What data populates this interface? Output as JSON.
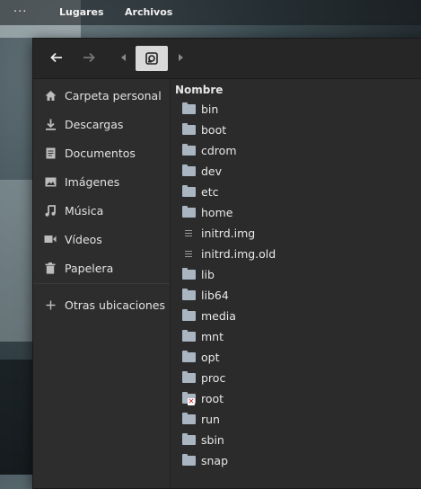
{
  "topbar": {
    "activities_icon": "dots-icon",
    "menu_places": "Lugares",
    "menu_files": "Archivos"
  },
  "header": {
    "back_icon": "arrow-left-icon",
    "forward_icon": "arrow-right-icon",
    "path_left_icon": "chevron-left-icon",
    "path_right_icon": "chevron-right-icon",
    "root_icon": "hard-disk-icon"
  },
  "sidebar": {
    "items": [
      {
        "label": "Carpeta personal",
        "icon": "home-icon"
      },
      {
        "label": "Descargas",
        "icon": "download-icon"
      },
      {
        "label": "Documentos",
        "icon": "document-icon"
      },
      {
        "label": "Imágenes",
        "icon": "image-icon"
      },
      {
        "label": "Música",
        "icon": "music-icon"
      },
      {
        "label": "Vídeos",
        "icon": "video-icon"
      },
      {
        "label": "Papelera",
        "icon": "trash-icon"
      },
      {
        "label": "Otras ubicaciones",
        "icon": "plus-icon"
      }
    ]
  },
  "main": {
    "column_header": "Nombre",
    "rows": [
      {
        "name": "bin",
        "type": "folder"
      },
      {
        "name": "boot",
        "type": "folder"
      },
      {
        "name": "cdrom",
        "type": "folder"
      },
      {
        "name": "dev",
        "type": "folder"
      },
      {
        "name": "etc",
        "type": "folder"
      },
      {
        "name": "home",
        "type": "folder"
      },
      {
        "name": "initrd.img",
        "type": "file"
      },
      {
        "name": "initrd.img.old",
        "type": "file"
      },
      {
        "name": "lib",
        "type": "folder"
      },
      {
        "name": "lib64",
        "type": "folder"
      },
      {
        "name": "media",
        "type": "folder"
      },
      {
        "name": "mnt",
        "type": "folder"
      },
      {
        "name": "opt",
        "type": "folder"
      },
      {
        "name": "proc",
        "type": "folder"
      },
      {
        "name": "root",
        "type": "folder-locked"
      },
      {
        "name": "run",
        "type": "folder"
      },
      {
        "name": "sbin",
        "type": "folder"
      },
      {
        "name": "snap",
        "type": "folder"
      }
    ]
  },
  "colors": {
    "window_bg": "#2b2b2b",
    "headerbar_bg": "#262626",
    "folder": "#a9b6c2",
    "text": "#e8e8e8"
  }
}
